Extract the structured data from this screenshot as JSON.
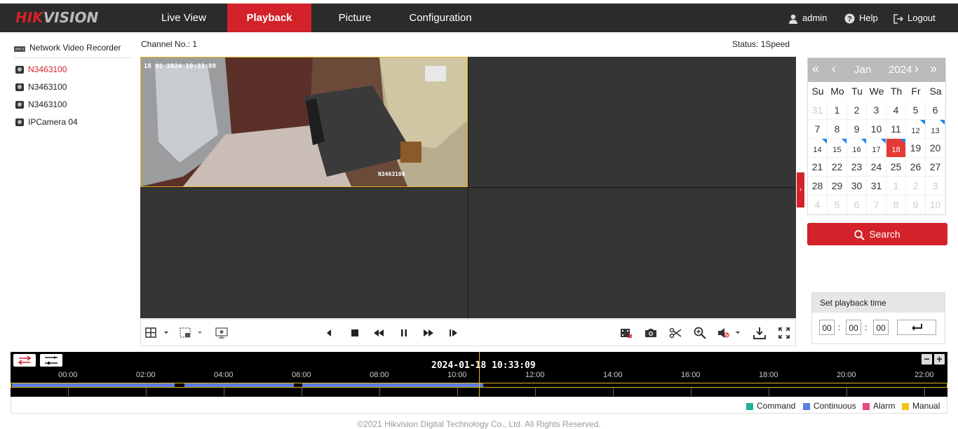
{
  "brand": {
    "logo_text": "HIKVISION",
    "accent": "#d3222a"
  },
  "nav": {
    "tabs": [
      "Live View",
      "Playback",
      "Picture",
      "Configuration"
    ],
    "active": "Playback"
  },
  "user": {
    "name": "admin",
    "help": "Help",
    "logout": "Logout"
  },
  "sidebar": {
    "root": "Network Video Recorder",
    "channels": [
      {
        "label": "N3463100",
        "active": true
      },
      {
        "label": "N3463100",
        "active": false
      },
      {
        "label": "N3463100",
        "active": false
      },
      {
        "label": "IPCamera 04",
        "active": false
      }
    ]
  },
  "main": {
    "channel_label": "Channel No.: 1",
    "status_label": "Status: 1Speed"
  },
  "video": {
    "overlay_timestamp": "18 01 2024 10:33:09",
    "overlay_camera": "N3463100"
  },
  "calendar": {
    "month": "Jan",
    "year": "2024",
    "weekdays": [
      "Su",
      "Mo",
      "Tu",
      "We",
      "Th",
      "Fr",
      "Sa"
    ],
    "weeks": [
      [
        {
          "d": "31",
          "dim": true
        },
        {
          "d": "1"
        },
        {
          "d": "2"
        },
        {
          "d": "3"
        },
        {
          "d": "4"
        },
        {
          "d": "5"
        },
        {
          "d": "6"
        }
      ],
      [
        {
          "d": "7"
        },
        {
          "d": "8"
        },
        {
          "d": "9"
        },
        {
          "d": "10"
        },
        {
          "d": "11"
        },
        {
          "d": "12",
          "rec": true
        },
        {
          "d": "13",
          "rec": true
        }
      ],
      [
        {
          "d": "14",
          "rec": true
        },
        {
          "d": "15",
          "rec": true
        },
        {
          "d": "16",
          "rec": true
        },
        {
          "d": "17",
          "rec": true
        },
        {
          "d": "18",
          "rec": true,
          "today": true
        },
        {
          "d": "19"
        },
        {
          "d": "20"
        }
      ],
      [
        {
          "d": "21"
        },
        {
          "d": "22"
        },
        {
          "d": "23"
        },
        {
          "d": "24"
        },
        {
          "d": "25"
        },
        {
          "d": "26"
        },
        {
          "d": "27"
        }
      ],
      [
        {
          "d": "28"
        },
        {
          "d": "29"
        },
        {
          "d": "30"
        },
        {
          "d": "31"
        },
        {
          "d": "1",
          "dim": true
        },
        {
          "d": "2",
          "dim": true
        },
        {
          "d": "3",
          "dim": true
        }
      ],
      [
        {
          "d": "4",
          "dim": true
        },
        {
          "d": "5",
          "dim": true
        },
        {
          "d": "6",
          "dim": true
        },
        {
          "d": "7",
          "dim": true
        },
        {
          "d": "8",
          "dim": true
        },
        {
          "d": "9",
          "dim": true
        },
        {
          "d": "10",
          "dim": true
        }
      ]
    ]
  },
  "search": {
    "label": "Search"
  },
  "playback_time": {
    "title": "Set playback time",
    "hh": "00",
    "mm": "00",
    "ss": "00"
  },
  "timeline": {
    "current": "2024-01-18 10:33:09",
    "ticks": [
      "00:00",
      "02:00",
      "04:00",
      "06:00",
      "08:00",
      "10:00",
      "12:00",
      "14:00",
      "16:00",
      "18:00",
      "20:00",
      "22:00"
    ]
  },
  "legend": [
    {
      "label": "Command",
      "color": "#21b39a"
    },
    {
      "label": "Continuous",
      "color": "#5b7ce0"
    },
    {
      "label": "Alarm",
      "color": "#e8477c"
    },
    {
      "label": "Manual",
      "color": "#f0c419"
    }
  ],
  "footer": "©2021 Hikvision Digital Technology Co., Ltd. All Rights Reserved."
}
